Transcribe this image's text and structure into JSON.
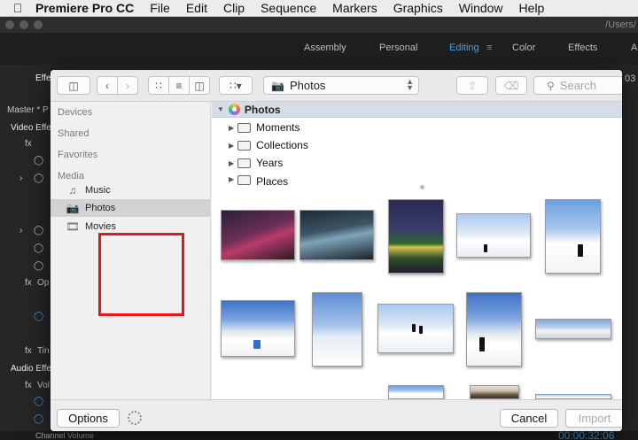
{
  "menubar": {
    "app_name": "Premiere Pro CC",
    "items": [
      "File",
      "Edit",
      "Clip",
      "Sequence",
      "Markers",
      "Graphics",
      "Window",
      "Help"
    ]
  },
  "titlebar": {
    "path": "/Users/"
  },
  "workspaces": {
    "items": [
      "Assembly",
      "Personal",
      "Editing",
      "Color",
      "Effects",
      "A"
    ],
    "active": "Editing"
  },
  "left_panel": {
    "tab": "Effe",
    "master": "Master * P",
    "video_effects": "Video Effe",
    "fx_op": "Op",
    "fx_tin": "Tin",
    "audio_effects": "Audio Effe",
    "fx_vol": "Vol"
  },
  "right_strip": {
    "text": "03"
  },
  "bottom_bar": {
    "channel_volume": "Channel Volume",
    "timecode": "00:00:32:06"
  },
  "dialog": {
    "toolbar": {
      "location_label": "Photos",
      "search_placeholder": "Search"
    },
    "sidebar": {
      "sections": {
        "devices": "Devices",
        "shared": "Shared",
        "favorites": "Favorites",
        "media": "Media"
      },
      "media_items": [
        {
          "label": "Music",
          "icon": "music-note-icon"
        },
        {
          "label": "Photos",
          "icon": "camera-icon"
        },
        {
          "label": "Movies",
          "icon": "film-icon"
        }
      ],
      "selected": "Photos"
    },
    "tree": {
      "root": "Photos",
      "items": [
        "Moments",
        "Collections",
        "Years",
        "Places"
      ]
    },
    "footer": {
      "options_label": "Options",
      "cancel_label": "Cancel",
      "import_label": "Import"
    }
  },
  "colors": {
    "accent_blue": "#3fa3f3",
    "highlight_red": "#e8161b",
    "selection_gray": "#d2d2d2"
  }
}
